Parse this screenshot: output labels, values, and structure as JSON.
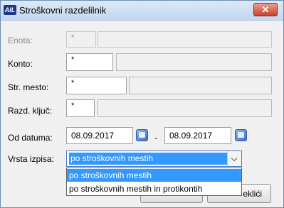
{
  "window": {
    "title": "Stroškovni razdelilnik",
    "logo_text": "AIL",
    "close_symbol": "✕"
  },
  "form": {
    "enota": {
      "label": "Enota:",
      "code": "*"
    },
    "konto": {
      "label": "Konto:",
      "code": "*"
    },
    "str_mesto": {
      "label": "Str. mesto:",
      "code": "*"
    },
    "razd_kljuc": {
      "label": "Razd. ključ:",
      "code": "*"
    },
    "od_datuma": {
      "label": "Od datuma:",
      "from": "08.09.2017",
      "separator": "-",
      "to": "08.09.2017"
    },
    "vrsta_izpisa": {
      "label": "Vrsta izpisa:",
      "selected": "po stroškovnih mestih",
      "options": [
        "po stroškovnih mestih",
        "po stroškovnih mestih in protikontih"
      ]
    }
  },
  "buttons": {
    "cancel_label": "eklići"
  },
  "icons": {
    "calendar": "calendar-icon",
    "close": "close-icon",
    "dropdown": "chevron-down-icon"
  },
  "colors": {
    "selection": "#3399ff",
    "titlebar": "#c3d7ef",
    "close_button": "#c7432a"
  }
}
